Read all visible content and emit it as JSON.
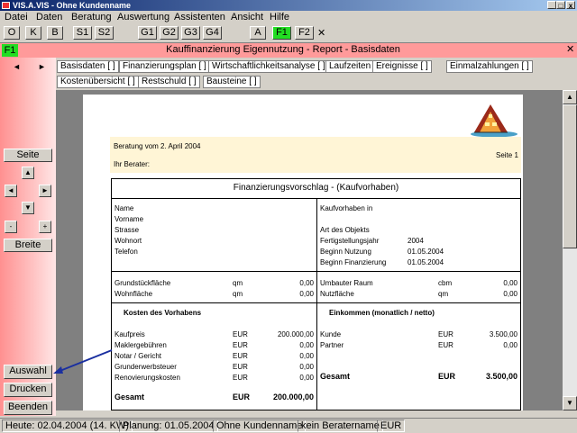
{
  "window": {
    "title": "VIS.A.VIS - Ohne Kundenname",
    "minimize": "_",
    "maximize": "□",
    "close": "x"
  },
  "menu": [
    "Datei",
    "Daten",
    "Beratung",
    "Auswertung",
    "Assistenten",
    "Ansicht",
    "Hilfe"
  ],
  "toolbar": {
    "buttons": [
      "O",
      "K",
      "B",
      "S1",
      "S2",
      "G1",
      "G2",
      "G3",
      "G4",
      "A",
      "F1",
      "F2"
    ],
    "close": "✕"
  },
  "header": {
    "f1": "F1",
    "title": "Kauffinanzierung Eigennutzung - Report - Basisdaten",
    "close": "✕"
  },
  "nav": {
    "left_arrow": "◄",
    "right_arrow": "►"
  },
  "tabs_row1": [
    "Basisdaten [ ]",
    "Finanzierungsplan [ ]",
    "Wirtschaftlichkeitsanalyse [ ]",
    "Laufzeiten [ ]",
    "Ereignisse [ ]",
    "Einmalzahlungen [ ]"
  ],
  "tabs_row2": [
    "Kostenübersicht [ ]",
    "Restschuld [ ]",
    "Bausteine [ ]"
  ],
  "left_panel": {
    "seite": "Seite",
    "up": "▲",
    "down": "▼",
    "left": "◄",
    "right": "►",
    "minus": "-",
    "plus": "+",
    "breite": "Breite",
    "auswahl": "Auswahl",
    "drucken": "Drucken",
    "beenden": "Beenden"
  },
  "report": {
    "beratung": "Beratung vom 2. April 2004",
    "seite": "Seite  1",
    "berater": "Ihr Berater:",
    "box_title": "Finanzierungsvorschlag -   (Kaufvorhaben)",
    "left_labels": [
      "Name",
      "Vorname",
      "Strasse",
      "Wohnort",
      "Telefon"
    ],
    "kaufvorhaben": "Kaufvorhaben in",
    "objekt": "Art des Objekts",
    "right_rows": [
      {
        "label": "Fertigstellungsjahr",
        "value": "2004"
      },
      {
        "label": "Beginn Nutzung",
        "value": "01.05.2004"
      },
      {
        "label": "Beginn Finanzierung",
        "value": "01.05.2004"
      }
    ],
    "area_rows": [
      {
        "label": "Grundstückfläche",
        "unit": "qm",
        "value": "0,00",
        "label2": "Umbauter Raum",
        "unit2": "cbm",
        "value2": "0,00"
      },
      {
        "label": "Wohnfläche",
        "unit": "qm",
        "value": "0,00",
        "label2": "Nutzfläche",
        "unit2": "qm",
        "value2": "0,00"
      }
    ],
    "kosten_title": "Kosten des Vorhabens",
    "einkommen_title": "Einkommen (monatlich / netto)",
    "kosten_rows": [
      {
        "label": "Kaufpreis",
        "unit": "EUR",
        "value": "200.000,00"
      },
      {
        "label": "Maklergebühren",
        "unit": "EUR",
        "value": "0,00"
      },
      {
        "label": "Notar / Gericht",
        "unit": "EUR",
        "value": "0,00"
      },
      {
        "label": "Grunderwerbsteuer",
        "unit": "EUR",
        "value": "0,00"
      },
      {
        "label": "Renovierungskosten",
        "unit": "EUR",
        "value": "0,00"
      }
    ],
    "einkommen_rows": [
      {
        "label": "Kunde",
        "unit": "EUR",
        "value": "3.500,00"
      },
      {
        "label": "Partner",
        "unit": "EUR",
        "value": "0,00"
      }
    ],
    "gesamt_kosten": {
      "label": "Gesamt",
      "unit": "EUR",
      "value": "200.000,00"
    },
    "gesamt_einkommen": {
      "label": "Gesamt",
      "unit": "EUR",
      "value": "3.500,00"
    }
  },
  "status": [
    "Heute: 02.04.2004 (14. KW)",
    "Planung: 01.05.2004",
    "Ohne Kundenname",
    "kein Beratername",
    "EUR"
  ],
  "colors": {
    "accent_green": "#22dd22",
    "panel_pink": "#ff9a9a",
    "report_highlight": "#fff5d6",
    "arrow": "#1a2fa0"
  }
}
